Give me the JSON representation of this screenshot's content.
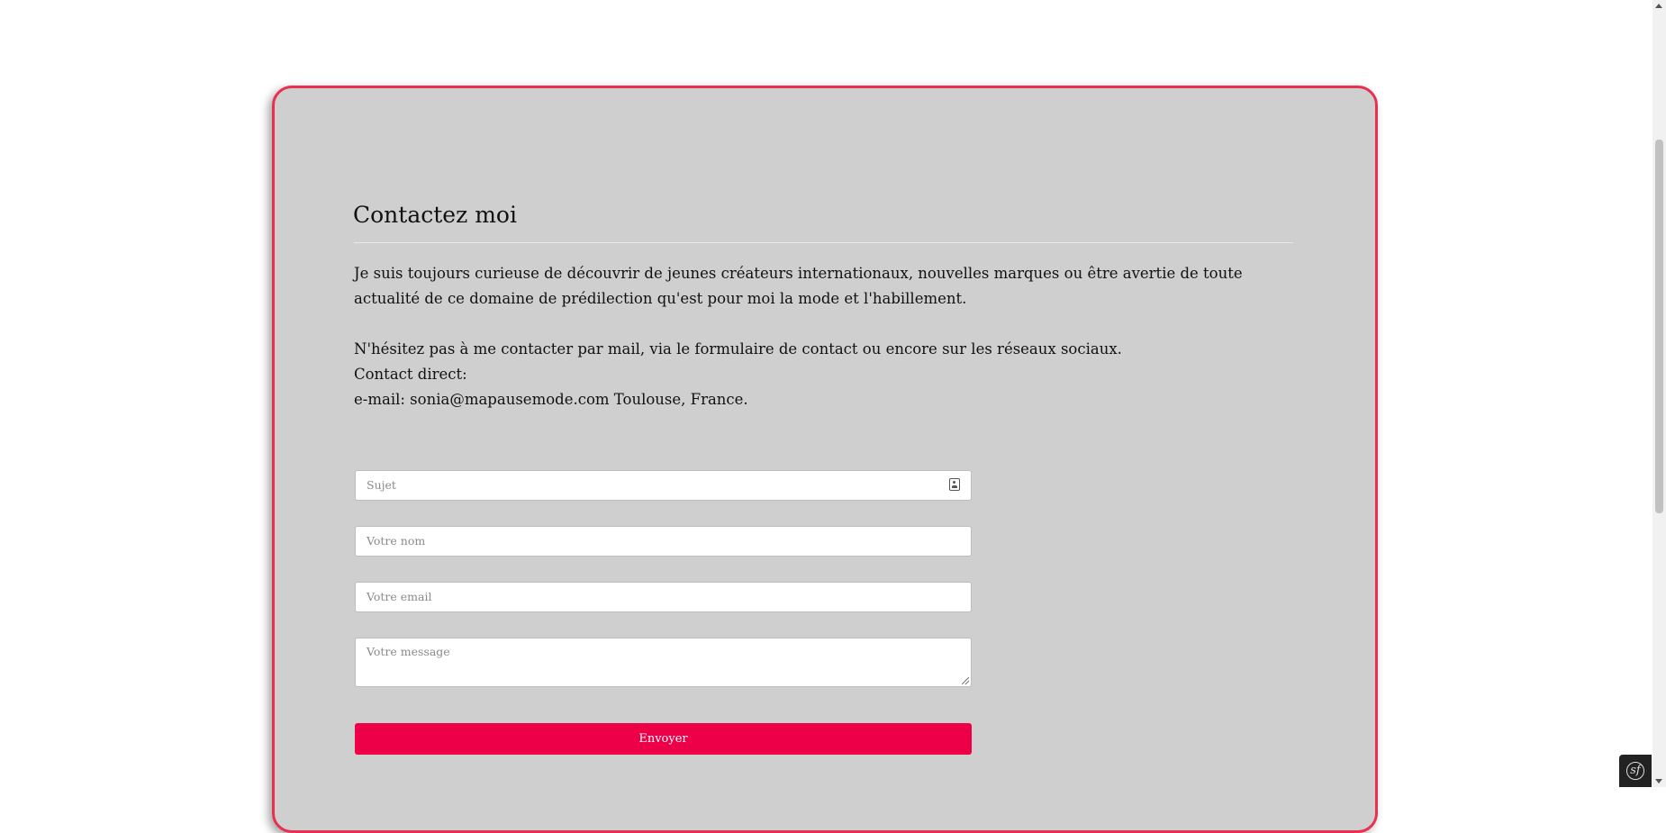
{
  "contact": {
    "heading": "Contactez moi",
    "paragraph1": "Je suis toujours curieuse de découvrir de jeunes créateurs internationaux, nouvelles marques ou être avertie de toute actualité de ce domaine de prédilection qu'est pour moi la mode et l'habillement.",
    "paragraph2": "N'hésitez pas à me contacter par mail, via le formulaire de contact ou encore sur les réseaux sociaux.",
    "direct_label": "Contact direct:",
    "email_line": "e-mail: sonia@mapausemode.com Toulouse, France."
  },
  "form": {
    "subject_placeholder": "Sujet",
    "name_placeholder": "Votre nom",
    "email_placeholder": "Votre email",
    "message_placeholder": "Votre message",
    "submit_label": "Envoyer"
  },
  "toolbar": {
    "logo_glyph": "sf"
  },
  "colors": {
    "card_border": "#e8304f",
    "card_background": "#cfcfcf",
    "submit_background": "#ee0048"
  }
}
